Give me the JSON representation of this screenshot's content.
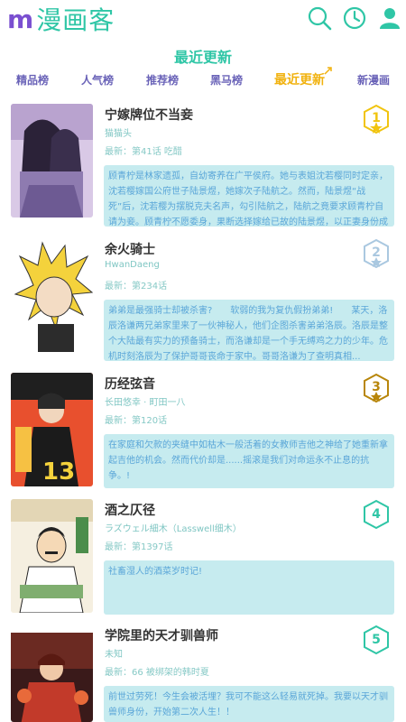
{
  "app": {
    "logo_m": "m",
    "logo_text": "漫画客"
  },
  "header_icons": {
    "search": "search-icon",
    "history": "clock-icon",
    "user": "user-icon"
  },
  "section_title": "最近更新",
  "tabs": [
    {
      "label": "精品榜",
      "active": false
    },
    {
      "label": "人气榜",
      "active": false
    },
    {
      "label": "推荐榜",
      "active": false
    },
    {
      "label": "黑马榜",
      "active": false
    },
    {
      "label": "最近更新",
      "active": true
    },
    {
      "label": "新漫画",
      "active": false
    }
  ],
  "colors": {
    "accent": "#2fc6a6",
    "tab": "#6a63b8",
    "active_tab": "#f1b20f",
    "desc_bg": "#c6ebef",
    "rank_gold": "#f1c40f",
    "rank_silver": "#aac8e0",
    "rank_bronze": "#b8860b",
    "rank_plain": "#2fc6a6"
  },
  "items": [
    {
      "rank": "1",
      "title": "宁嫁牌位不当妾",
      "author": "猫猫头",
      "latest": "最新：第41话 吃醋",
      "desc": "顾青柠是林家遗孤，自幼寄养在广平侯府。她与表姐沈若樱同时定亲，沈若樱嫁国公府世子陆景煜，她嫁次子陆航之。然而，陆景煜“战死”后，沈若樱为摆脱克夫名声，勾引陆航之，陆航之竟要求顾青柠自请为妾。顾青柠不愿委身，果断选择嫁给已故的陆景煜，以正妻身份成为..."
    },
    {
      "rank": "2",
      "title": "余火骑士",
      "author": "HwanDaeng",
      "latest": "最新：第234话",
      "desc": "弟弟是最强骑士却被杀害?　　软弱的我为复仇假扮弟弟!　　某天，洛辰洛谦两兄弟家里来了一伙神秘人，他们企图杀害弟弟洛辰。洛辰是整个大陆最有实力的预备骑士，而洛谦却是一个手无缚鸡之力的少年。危机时刻洛辰为了保护哥哥丧命于家中。哥哥洛谦为了查明真相..."
    },
    {
      "rank": "3",
      "title": "历经弦音",
      "author": "长田悠幸 · 町田一八",
      "latest": "最新：第120话",
      "desc": "在家庭和欠款的夹缝中如枯木一般活着的女教师吉他之神给了她重新拿起吉他的机会。然而代价却是......摇滚是我们对命运永不止息的抗争。!"
    },
    {
      "rank": "4",
      "title": "酒之仄径",
      "author": "ラズウェル細木（Lasswell细木）",
      "latest": "最新：第1397话",
      "desc": "社畜湿人的酒菜岁时记!"
    },
    {
      "rank": "5",
      "title": "学院里的天才驯兽师",
      "author": "未知",
      "latest": "最新：66 被绑架的韩时夏",
      "desc": "前世过劳死！今生会被活埋？我可不能这么轻易就死掉。我要以天才驯兽师身份，开始第二次人生！！"
    }
  ]
}
